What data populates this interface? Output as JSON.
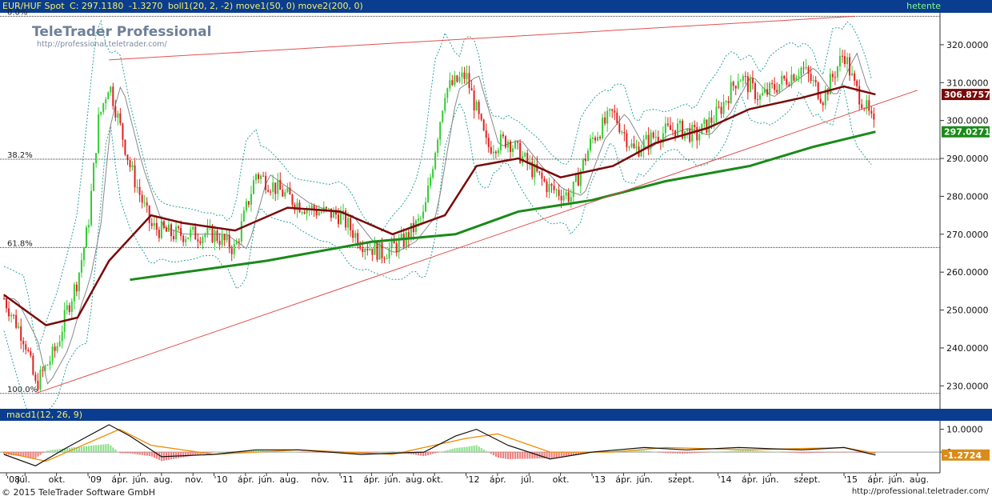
{
  "header": {
    "symbol": "EUR/HUF Spot",
    "close": "C: 297.1180",
    "change": "-1.3270",
    "indicators": "boll1(20, 2, -2) move1(50, 0) move2(200, 0)",
    "period": "hetente"
  },
  "watermark": {
    "title": "TeleTrader Professional",
    "url": "http://professional.teletrader.com/"
  },
  "price_tags": {
    "ma50": "306.8757",
    "ma200": "297.0271"
  },
  "macd_header": "macd1(12, 26, 9)",
  "macd_tag": "-1.2724",
  "footer": {
    "copyright": "© 2015 TeleTrader Software GmbH",
    "url": "http://professional.teletrader.com/"
  },
  "colors": {
    "up": "#33cc33",
    "down": "#e02020",
    "ma50": "#7a0a0a",
    "ma200": "#1a8a1a",
    "boll": "#2aa39a",
    "trend": "#e05050",
    "header_bg": "#0a3d8f"
  },
  "chart_data": {
    "type": "candlestick",
    "instrument": "EUR/HUF Spot",
    "frequency": "hetente",
    "ylim": [
      225,
      328
    ],
    "y_ticks": [
      "230.0000",
      "240.0000",
      "250.0000",
      "260.0000",
      "270.0000",
      "280.0000",
      "290.0000",
      "300.0000",
      "310.0000",
      "320.0000"
    ],
    "x_ticks": [
      "'08",
      "júl.",
      "okt.",
      "'09",
      "ápr.",
      "jún.",
      "aug.",
      "nov.",
      "'10",
      "ápr.",
      "jún.",
      "aug.",
      "nov.",
      "'11",
      "ápr.",
      "jún.",
      "aug.",
      "okt.",
      "'12",
      "ápr.",
      "júl.",
      "okt.",
      "'13",
      "ápr.",
      "jún.",
      "szept.",
      "'14",
      "ápr.",
      "jún.",
      "szept.",
      "'15",
      "ápr.",
      "jún.",
      "aug."
    ],
    "fib_levels": [
      {
        "label": "0.0%",
        "value": 327.5
      },
      {
        "label": "38.2%",
        "value": 289.8
      },
      {
        "label": "61.8%",
        "value": 266.5
      },
      {
        "label": "100.0%",
        "value": 228.0
      }
    ],
    "price_path": [
      {
        "date": "2008-05",
        "value": 253
      },
      {
        "date": "2008-07",
        "value": 242
      },
      {
        "date": "2008-08",
        "value": 230
      },
      {
        "date": "2008-10",
        "value": 240
      },
      {
        "date": "2008-11",
        "value": 250
      },
      {
        "date": "2008-12",
        "value": 258
      },
      {
        "date": "2009-01",
        "value": 272
      },
      {
        "date": "2009-02",
        "value": 300
      },
      {
        "date": "2009-03",
        "value": 310
      },
      {
        "date": "2009-05",
        "value": 288
      },
      {
        "date": "2009-07",
        "value": 272
      },
      {
        "date": "2009-09",
        "value": 270
      },
      {
        "date": "2009-11",
        "value": 270
      },
      {
        "date": "2010-01",
        "value": 270
      },
      {
        "date": "2010-03",
        "value": 266
      },
      {
        "date": "2010-05",
        "value": 286
      },
      {
        "date": "2010-07",
        "value": 282
      },
      {
        "date": "2010-09",
        "value": 278
      },
      {
        "date": "2010-11",
        "value": 276
      },
      {
        "date": "2011-01",
        "value": 275
      },
      {
        "date": "2011-03",
        "value": 268
      },
      {
        "date": "2011-05",
        "value": 265
      },
      {
        "date": "2011-07",
        "value": 268
      },
      {
        "date": "2011-09",
        "value": 275
      },
      {
        "date": "2011-11",
        "value": 308
      },
      {
        "date": "2012-01",
        "value": 312
      },
      {
        "date": "2012-03",
        "value": 293
      },
      {
        "date": "2012-05",
        "value": 295
      },
      {
        "date": "2012-07",
        "value": 288
      },
      {
        "date": "2012-09",
        "value": 282
      },
      {
        "date": "2012-11",
        "value": 280
      },
      {
        "date": "2013-01",
        "value": 295
      },
      {
        "date": "2013-03",
        "value": 302
      },
      {
        "date": "2013-05",
        "value": 292
      },
      {
        "date": "2013-07",
        "value": 296
      },
      {
        "date": "2013-09",
        "value": 298
      },
      {
        "date": "2013-11",
        "value": 296
      },
      {
        "date": "2014-01",
        "value": 302
      },
      {
        "date": "2014-03",
        "value": 312
      },
      {
        "date": "2014-05",
        "value": 306
      },
      {
        "date": "2014-07",
        "value": 310
      },
      {
        "date": "2014-09",
        "value": 314
      },
      {
        "date": "2014-11",
        "value": 306
      },
      {
        "date": "2015-01",
        "value": 318
      },
      {
        "date": "2015-02",
        "value": 309
      },
      {
        "date": "2015-03",
        "value": 304
      },
      {
        "date": "2015-04",
        "value": 297
      }
    ],
    "ma50": [
      {
        "date": "2008-05",
        "value": 254
      },
      {
        "date": "2008-09",
        "value": 246
      },
      {
        "date": "2008-12",
        "value": 248
      },
      {
        "date": "2009-03",
        "value": 263
      },
      {
        "date": "2009-07",
        "value": 275
      },
      {
        "date": "2009-10",
        "value": 273
      },
      {
        "date": "2010-03",
        "value": 271
      },
      {
        "date": "2010-08",
        "value": 277
      },
      {
        "date": "2011-01",
        "value": 276
      },
      {
        "date": "2011-06",
        "value": 270
      },
      {
        "date": "2011-11",
        "value": 275
      },
      {
        "date": "2012-02",
        "value": 288
      },
      {
        "date": "2012-06",
        "value": 290
      },
      {
        "date": "2012-10",
        "value": 285
      },
      {
        "date": "2013-03",
        "value": 288
      },
      {
        "date": "2013-07",
        "value": 294
      },
      {
        "date": "2013-12",
        "value": 298
      },
      {
        "date": "2014-04",
        "value": 303
      },
      {
        "date": "2014-09",
        "value": 306
      },
      {
        "date": "2015-01",
        "value": 309
      },
      {
        "date": "2015-04",
        "value": 306.8757
      }
    ],
    "ma200": [
      {
        "date": "2009-05",
        "value": 258
      },
      {
        "date": "2010-06",
        "value": 263
      },
      {
        "date": "2011-04",
        "value": 268
      },
      {
        "date": "2011-12",
        "value": 270
      },
      {
        "date": "2012-06",
        "value": 276
      },
      {
        "date": "2013-01",
        "value": 279
      },
      {
        "date": "2013-08",
        "value": 284
      },
      {
        "date": "2014-04",
        "value": 288
      },
      {
        "date": "2014-10",
        "value": 293
      },
      {
        "date": "2015-04",
        "value": 297.0271
      }
    ],
    "trendlines": [
      {
        "from": {
          "date": "2009-03",
          "value": 316
        },
        "to": {
          "date": "2015-02",
          "value": 327.5
        }
      },
      {
        "from": {
          "date": "2008-08",
          "value": 228
        },
        "to": {
          "date": "2015-08",
          "value": 308
        }
      }
    ],
    "macd": {
      "y_ticks": [
        "10.0000",
        "0"
      ],
      "ylim": [
        -8,
        13
      ],
      "macd_path": [
        {
          "date": "2008-05",
          "value": -1
        },
        {
          "date": "2008-08",
          "value": -6
        },
        {
          "date": "2008-11",
          "value": 2
        },
        {
          "date": "2009-01",
          "value": 7
        },
        {
          "date": "2009-03",
          "value": 12
        },
        {
          "date": "2009-05",
          "value": 7
        },
        {
          "date": "2009-08",
          "value": -2
        },
        {
          "date": "2010-01",
          "value": -1
        },
        {
          "date": "2010-05",
          "value": 1
        },
        {
          "date": "2010-09",
          "value": 1
        },
        {
          "date": "2011-03",
          "value": -1
        },
        {
          "date": "2011-09",
          "value": 0
        },
        {
          "date": "2011-12",
          "value": 7
        },
        {
          "date": "2012-02",
          "value": 10
        },
        {
          "date": "2012-05",
          "value": 3
        },
        {
          "date": "2012-09",
          "value": -3
        },
        {
          "date": "2013-01",
          "value": 0
        },
        {
          "date": "2013-06",
          "value": 2
        },
        {
          "date": "2013-10",
          "value": 1
        },
        {
          "date": "2014-03",
          "value": 2
        },
        {
          "date": "2014-09",
          "value": 1
        },
        {
          "date": "2015-01",
          "value": 2
        },
        {
          "date": "2015-04",
          "value": -1.2724
        }
      ],
      "signal_path": [
        {
          "date": "2008-05",
          "value": 0
        },
        {
          "date": "2008-09",
          "value": -4
        },
        {
          "date": "2009-01",
          "value": 4
        },
        {
          "date": "2009-04",
          "value": 10
        },
        {
          "date": "2009-07",
          "value": 3
        },
        {
          "date": "2010-01",
          "value": -1
        },
        {
          "date": "2010-09",
          "value": 1
        },
        {
          "date": "2011-06",
          "value": -1
        },
        {
          "date": "2012-01",
          "value": 6
        },
        {
          "date": "2012-04",
          "value": 8
        },
        {
          "date": "2012-09",
          "value": 0
        },
        {
          "date": "2013-03",
          "value": 0
        },
        {
          "date": "2013-08",
          "value": 2
        },
        {
          "date": "2014-04",
          "value": 1
        },
        {
          "date": "2015-01",
          "value": 2
        },
        {
          "date": "2015-04",
          "value": -0.5
        }
      ]
    }
  }
}
